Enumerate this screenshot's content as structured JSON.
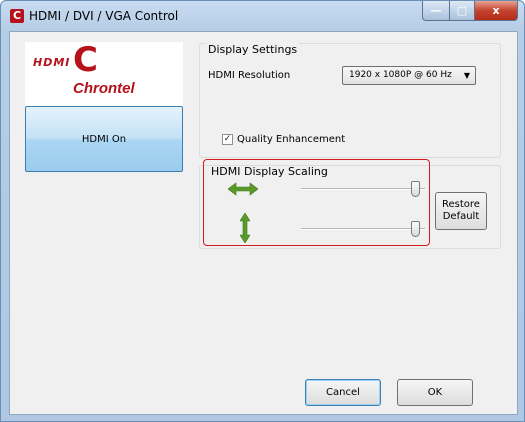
{
  "window": {
    "title": "HDMI / DVI / VGA Control",
    "app_icon_glyph": "C",
    "minimize_glyph": "—",
    "maximize_glyph": "□",
    "close_glyph": "x"
  },
  "logo": {
    "hdmi_text": "HDMI",
    "brand_text": "Chrontel",
    "brand_color": "#b5121b"
  },
  "left_panel": {
    "hdmi_on_label": "HDMI On"
  },
  "display_settings": {
    "title": "Display Settings",
    "resolution_label": "HDMI Resolution",
    "resolution_value": "1920 x 1080P @ 60 Hz",
    "quality_enhancement_label": "Quality Enhancement",
    "quality_enhancement_checked": true
  },
  "scaling": {
    "title": "HDMI Display Scaling",
    "horizontal_icon": "horizontal-arrows-icon",
    "vertical_icon": "vertical-arrows-icon",
    "horizontal_level": 0.92,
    "vertical_level": 0.92,
    "restore_label": "Restore\nDefault",
    "highlight_color": "#d01c1c"
  },
  "footer": {
    "cancel_label": "Cancel",
    "ok_label": "OK"
  }
}
